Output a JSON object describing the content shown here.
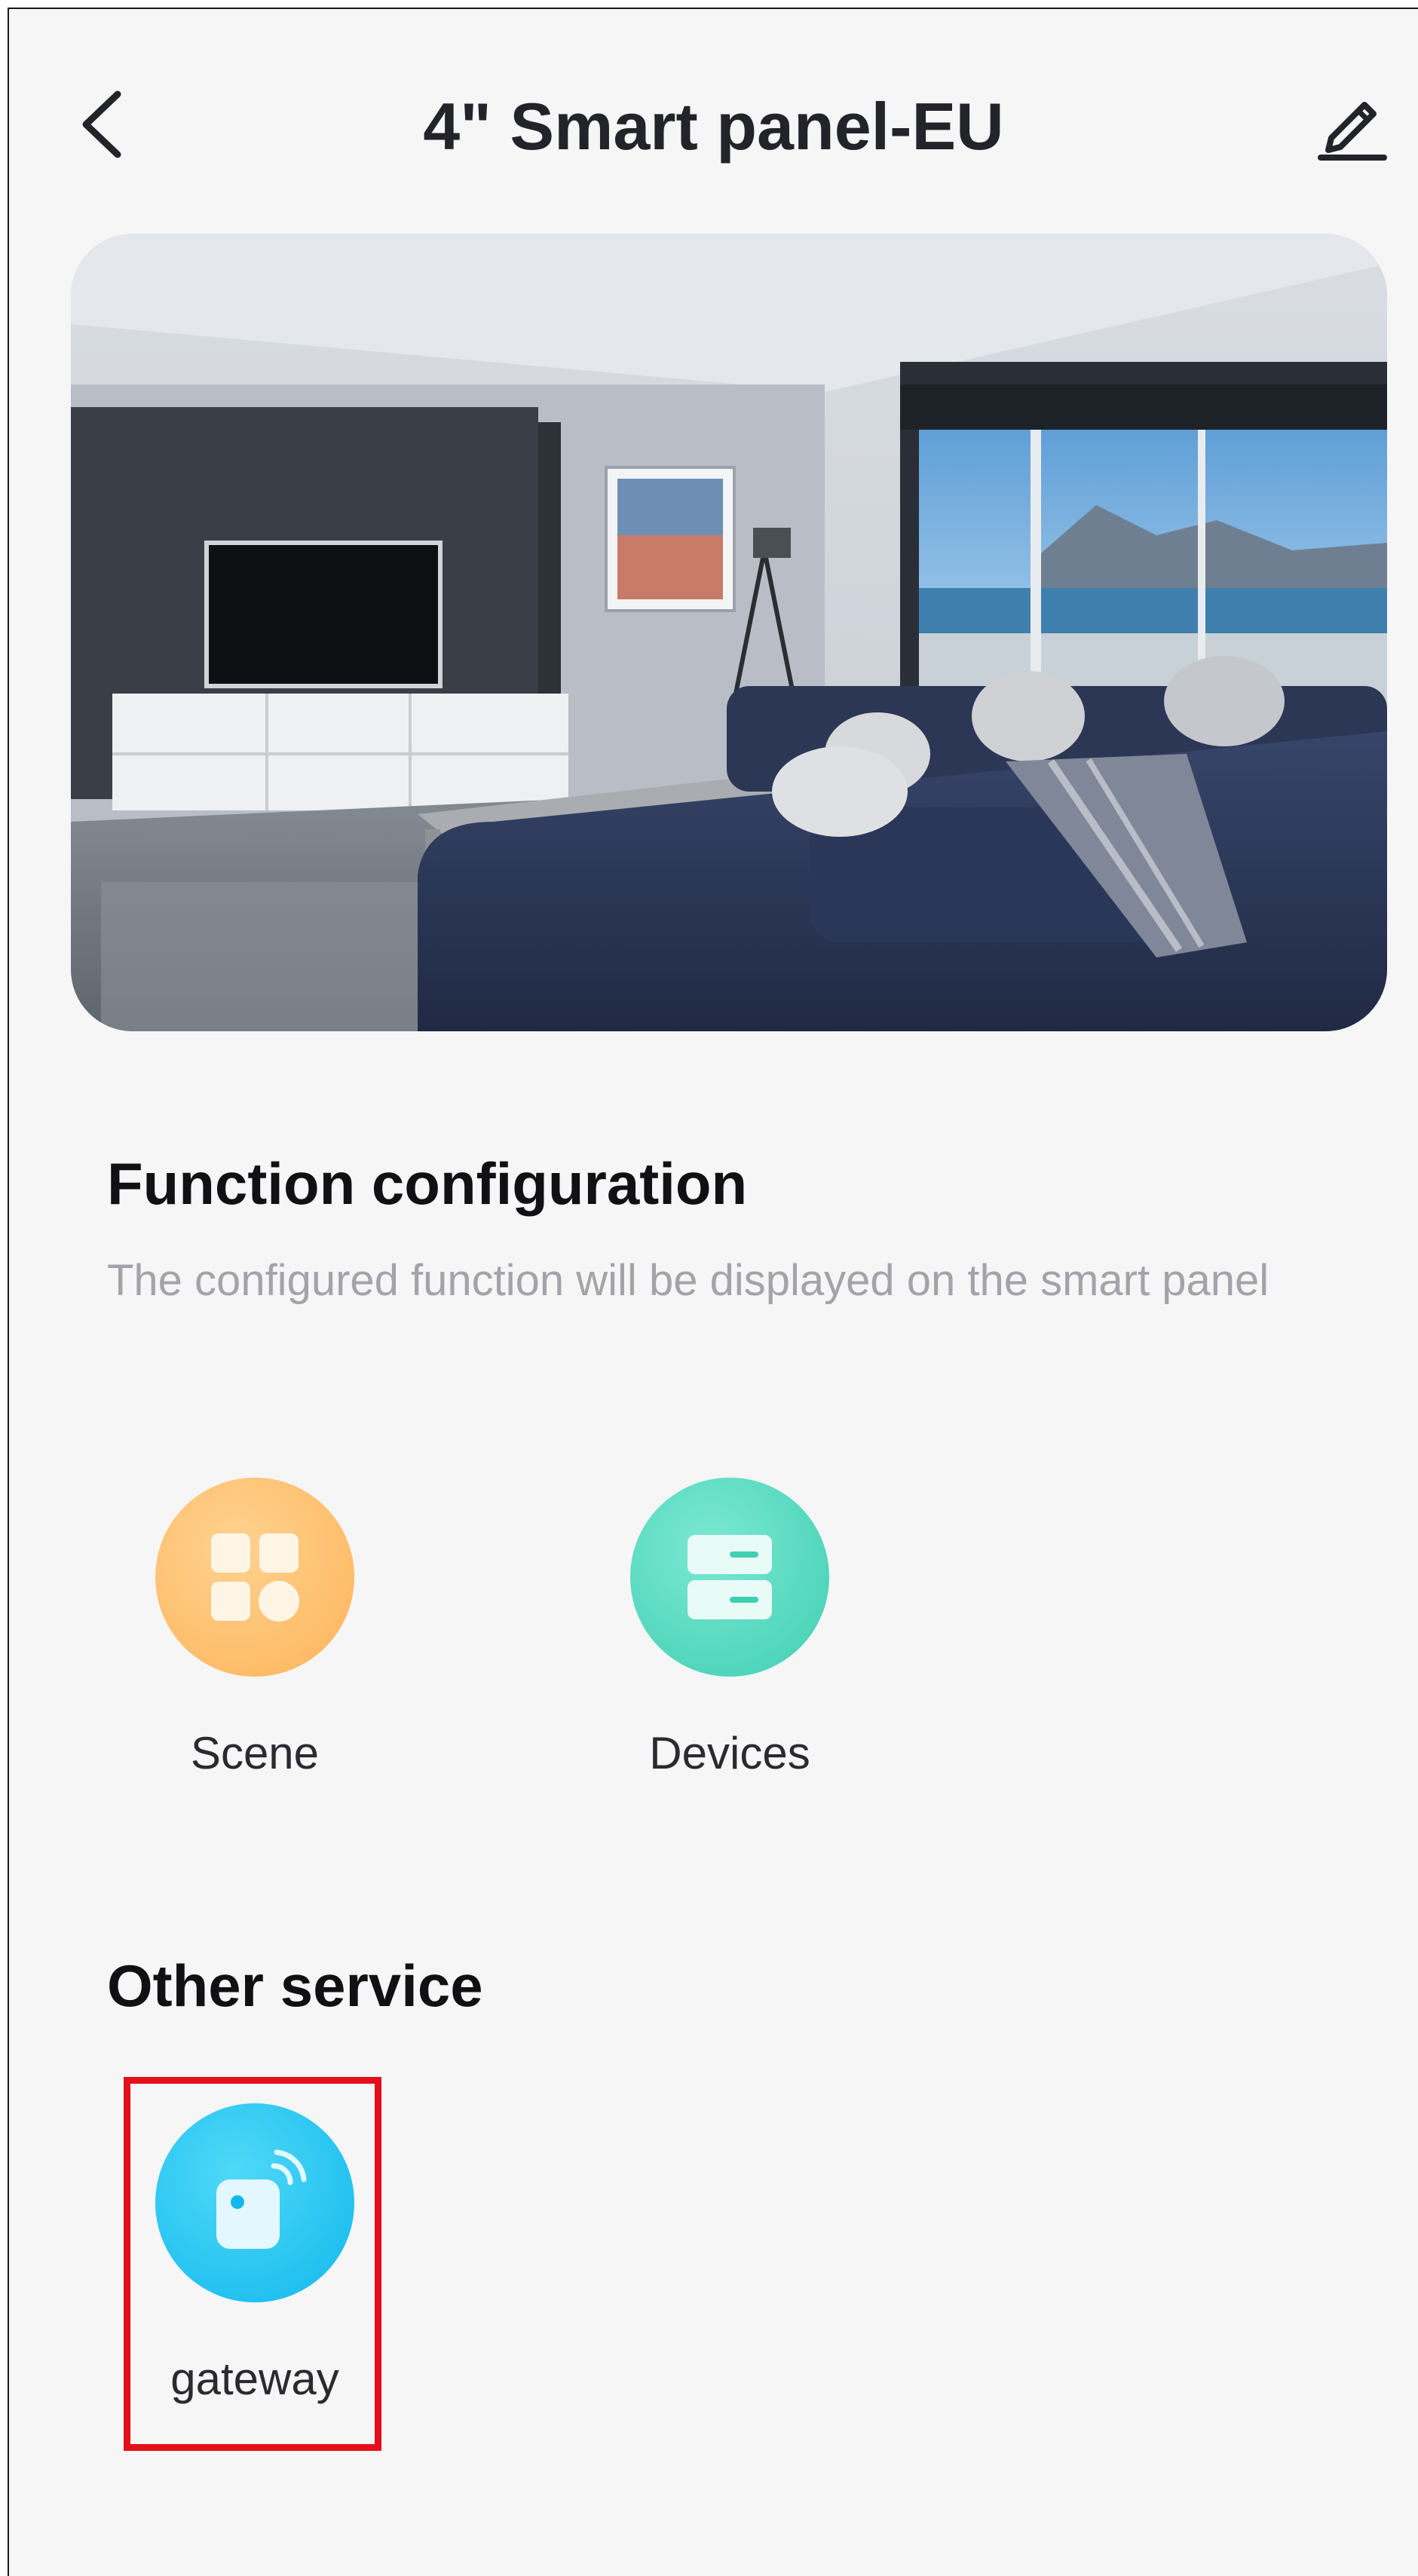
{
  "header": {
    "title": "4\" Smart panel-EU",
    "back_icon": "back-chevron-icon",
    "edit_icon": "edit-pencil-icon"
  },
  "hero": {
    "image": "living-room-photo"
  },
  "function_configuration": {
    "title": "Function configuration",
    "description": "The configured function will be displayed on the smart panel",
    "items": [
      {
        "label": "Scene",
        "icon": "scene-grid-icon",
        "color": "#fdb45a"
      },
      {
        "label": "Devices",
        "icon": "devices-icon",
        "color": "#3fcfb3"
      }
    ]
  },
  "other_service": {
    "title": "Other service",
    "items": [
      {
        "label": "gateway",
        "icon": "gateway-icon",
        "color": "#12b8ec"
      }
    ]
  },
  "colors": {
    "background": "#f6f6f7",
    "highlight": "#e3101c"
  }
}
